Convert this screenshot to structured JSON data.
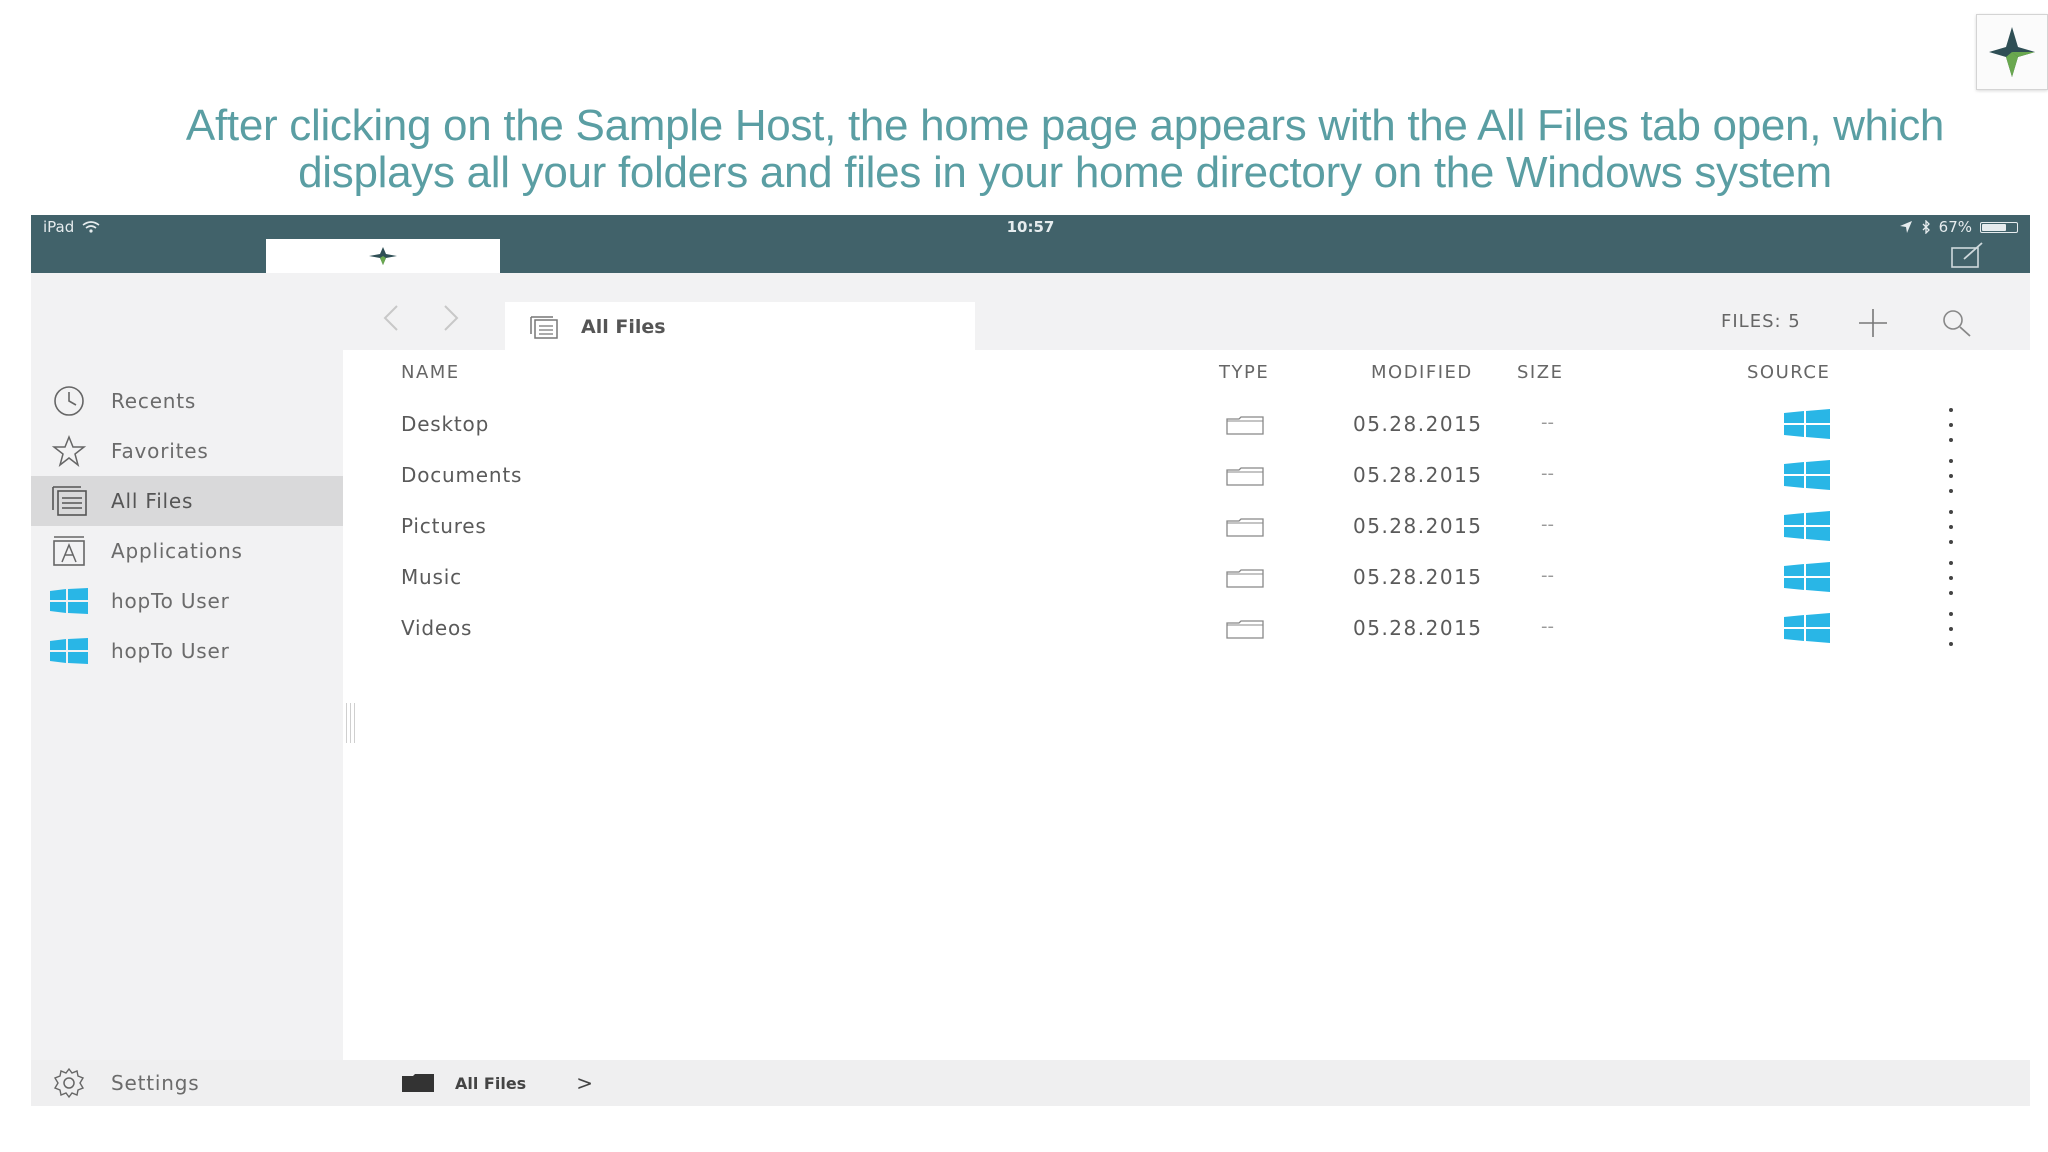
{
  "caption": {
    "line1": "After clicking on the Sample Host, the home page appears with the All Files tab open, which",
    "line2": "displays all your folders and files in your home directory on the Windows system"
  },
  "status_bar": {
    "device": "iPad",
    "time": "10:57",
    "battery": "67%",
    "battery_level": 0.67
  },
  "toolbar": {
    "current_tab": "All Files",
    "files_count": "FILES: 5"
  },
  "sidebar": {
    "items": [
      {
        "label": "Recents",
        "icon": "clock-icon"
      },
      {
        "label": "Favorites",
        "icon": "star-icon"
      },
      {
        "label": "All Files",
        "icon": "all-files-icon",
        "active": true
      },
      {
        "label": "Applications",
        "icon": "applications-icon"
      },
      {
        "label": "hopTo User",
        "icon": "windows-icon"
      },
      {
        "label": "hopTo User",
        "icon": "windows-icon"
      }
    ],
    "settings": "Settings"
  },
  "table": {
    "columns": [
      "NAME",
      "TYPE",
      "MODIFIED",
      "SIZE",
      "SOURCE"
    ],
    "rows": [
      {
        "name": "Desktop",
        "type": "folder-icon",
        "modified": "05.28.2015",
        "size": "--",
        "source": "windows-icon"
      },
      {
        "name": "Documents",
        "type": "folder-icon",
        "modified": "05.28.2015",
        "size": "--",
        "source": "windows-icon"
      },
      {
        "name": "Pictures",
        "type": "folder-icon",
        "modified": "05.28.2015",
        "size": "--",
        "source": "windows-icon"
      },
      {
        "name": "Music",
        "type": "folder-icon",
        "modified": "05.28.2015",
        "size": "--",
        "source": "windows-icon"
      },
      {
        "name": "Videos",
        "type": "folder-icon",
        "modified": "05.28.2015",
        "size": "--",
        "source": "windows-icon"
      }
    ]
  },
  "breadcrumb": {
    "label": "All Files",
    "chevron": ">"
  },
  "colors": {
    "caption": "#5a9ea3",
    "status_bar": "#41626a",
    "windows_blue": "#29b6e6",
    "logo_green": "#6aa84f",
    "logo_dark": "#2f4f55"
  }
}
